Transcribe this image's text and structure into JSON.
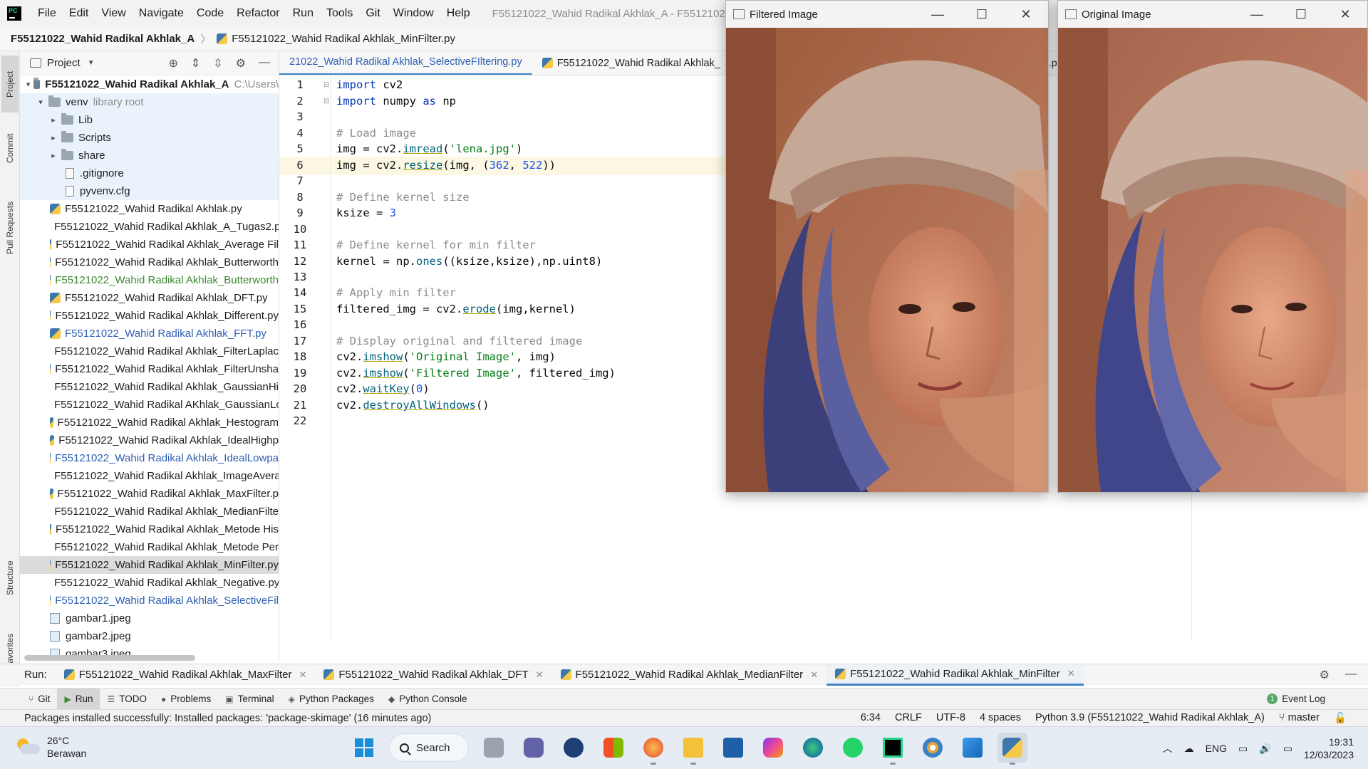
{
  "menubar": {
    "items": [
      "File",
      "Edit",
      "View",
      "Navigate",
      "Code",
      "Refactor",
      "Run",
      "Tools",
      "Git",
      "Window",
      "Help"
    ],
    "window_title": "F55121022_Wahid Radikal Akhlak_A - F55121022_Wahid R"
  },
  "breadcrumb": {
    "root": "F55121022_Wahid Radikal Akhlak_A",
    "file": "F55121022_Wahid Radikal Akhlak_MinFilter.py"
  },
  "left_strip": {
    "project": "Project",
    "commit": "Commit",
    "pull_requests": "Pull Requests",
    "structure": "Structure",
    "favorites": "Favorites"
  },
  "project_panel": {
    "title": "Project",
    "root": {
      "name": "F55121022_Wahid Radikal Akhlak_A",
      "path": "C:\\Users\\"
    },
    "venv": {
      "name": "venv",
      "hint": "library root"
    },
    "venv_children": [
      "Lib",
      "Scripts",
      "share"
    ],
    "venv_files": [
      ".gitignore",
      "pyvenv.cfg"
    ],
    "files": [
      {
        "name": "F55121022_Wahid Radikal Akhlak.py",
        "style": "normal"
      },
      {
        "name": "F55121022_Wahid Radikal Akhlak_A_Tugas2.p",
        "style": "normal"
      },
      {
        "name": "F55121022_Wahid Radikal Akhlak_Average Fil",
        "style": "normal"
      },
      {
        "name": "F55121022_Wahid Radikal Akhlak_Butterworth",
        "style": "normal"
      },
      {
        "name": "F55121022_Wahid Radikal Akhlak_Butterworth",
        "style": "green"
      },
      {
        "name": "F55121022_Wahid Radikal Akhlak_DFT.py",
        "style": "normal"
      },
      {
        "name": "F55121022_Wahid Radikal Akhlak_Different.py",
        "style": "normal"
      },
      {
        "name": "F55121022_Wahid Radikal Akhlak_FFT.py",
        "style": "blue"
      },
      {
        "name": "F55121022_Wahid Radikal Akhlak_FilterLaplac",
        "style": "normal"
      },
      {
        "name": "F55121022_Wahid Radikal Akhlak_FilterUnsha",
        "style": "normal"
      },
      {
        "name": "F55121022_Wahid Radikal Akhlak_GaussianHi",
        "style": "normal"
      },
      {
        "name": "F55121022_Wahid Radikal AKhlak_GaussianLo",
        "style": "normal"
      },
      {
        "name": "F55121022_Wahid Radikal Akhlak_Hestogram",
        "style": "normal"
      },
      {
        "name": "F55121022_Wahid Radikal Akhlak_IdealHighp",
        "style": "normal"
      },
      {
        "name": "F55121022_Wahid Radikal Akhlak_IdealLowpa",
        "style": "blue"
      },
      {
        "name": "F55121022_Wahid Radikal Akhlak_ImageAvera",
        "style": "normal"
      },
      {
        "name": "F55121022_Wahid Radikal Akhlak_MaxFilter.p",
        "style": "normal"
      },
      {
        "name": "F55121022_Wahid Radikal Akhlak_MedianFilte",
        "style": "normal"
      },
      {
        "name": "F55121022_Wahid Radikal Akhlak_Metode His",
        "style": "normal"
      },
      {
        "name": "F55121022_Wahid Radikal Akhlak_Metode Per",
        "style": "normal"
      },
      {
        "name": "F55121022_Wahid Radikal Akhlak_MinFilter.py",
        "style": "selected"
      },
      {
        "name": "F55121022_Wahid Radikal Akhlak_Negative.py",
        "style": "normal"
      },
      {
        "name": "F55121022_Wahid Radikal Akhlak_SelectiveFil",
        "style": "blue"
      }
    ],
    "images": [
      "gambar1.jpeg",
      "gambar2.jpeg",
      "gambar3.jpeg"
    ]
  },
  "editor": {
    "tabs": [
      "21022_Wahid Radikal Akhlak_SelectiveFIltering.py",
      "F55121022_Wahid Radikal Akhlak_"
    ],
    "line_numbers": [
      "1",
      "2",
      "3",
      "4",
      "5",
      "6",
      "7",
      "8",
      "9",
      "10",
      "11",
      "12",
      "13",
      "14",
      "15",
      "16",
      "17",
      "18",
      "19",
      "20",
      "21",
      "22"
    ],
    "tab_overflow_tail": ".py",
    "code": {
      "l1": {
        "kw": "import",
        "rest": " cv2"
      },
      "l2": {
        "kw1": "import",
        "mid": " numpy ",
        "kw2": "as",
        "rest": " np"
      },
      "l4": "# Load image",
      "l5": {
        "a": "img = cv2.",
        "fn": "imread",
        "b": "(",
        "st": "'lena.jpg'",
        "c": ")"
      },
      "l6": {
        "a": "img = cv2.",
        "fn": "resize",
        "b": "(img, (",
        "n1": "362",
        "sep": ", ",
        "n2": "522",
        "c": "))"
      },
      "l8": "# Define kernel size",
      "l9": {
        "a": "ksize = ",
        "n": "3"
      },
      "l11": "# Define kernel for min filter",
      "l12": {
        "a": "kernel = np.",
        "fn": "ones",
        "b": "((ksize,ksize),np.uint8)"
      },
      "l14": "# Apply min filter",
      "l15": {
        "a": "filtered_img = cv2.",
        "fn": "erode",
        "b": "(img,kernel)"
      },
      "l17": "# Display original and filtered image",
      "l18": {
        "a": "cv2.",
        "fn": "imshow",
        "b": "(",
        "st": "'Original Image'",
        "c": ", img)"
      },
      "l19": {
        "a": "cv2.",
        "fn": "imshow",
        "b": "(",
        "st": "'Filtered Image'",
        "c": ", filtered_img)"
      },
      "l20": {
        "a": "cv2.",
        "fn": "waitKey",
        "b": "(",
        "n": "0",
        "c": ")"
      },
      "l21": {
        "a": "cv2.",
        "fn": "destroyAllWindows",
        "b": "()"
      }
    }
  },
  "windows": {
    "filtered": "Filtered Image",
    "original": "Original Image"
  },
  "run_bar": {
    "label": "Run:",
    "tabs": [
      "F55121022_Wahid Radikal Akhlak_MaxFilter",
      "F55121022_Wahid Radikal Akhlak_DFT",
      "F55121022_Wahid Radikal Akhlak_MedianFilter",
      "F55121022_Wahid Radikal Akhlak_MinFilter"
    ]
  },
  "tool_bar": {
    "items": [
      "Git",
      "Run",
      "TODO",
      "Problems",
      "Terminal",
      "Python Packages",
      "Python Console"
    ],
    "event_log": "Event Log"
  },
  "status_bar": {
    "message": "Packages installed successfully: Installed packages: 'package-skimage' (16 minutes ago)",
    "position": "6:34",
    "line_sep": "CRLF",
    "encoding": "UTF-8",
    "indent": "4 spaces",
    "interpreter": "Python 3.9 (F55121022_Wahid Radikal Akhlak_A)",
    "branch": "master"
  },
  "taskbar": {
    "temp": "26°C",
    "weather": "Berawan",
    "search": "Search",
    "lang": "ENG",
    "time": "19:31",
    "date": "12/03/2023"
  },
  "colors": {
    "accent": "#4083c9",
    "keyword": "#0033b3",
    "string": "#067d17",
    "comment": "#8c8c8c",
    "number": "#1750eb",
    "function": "#00627a"
  }
}
